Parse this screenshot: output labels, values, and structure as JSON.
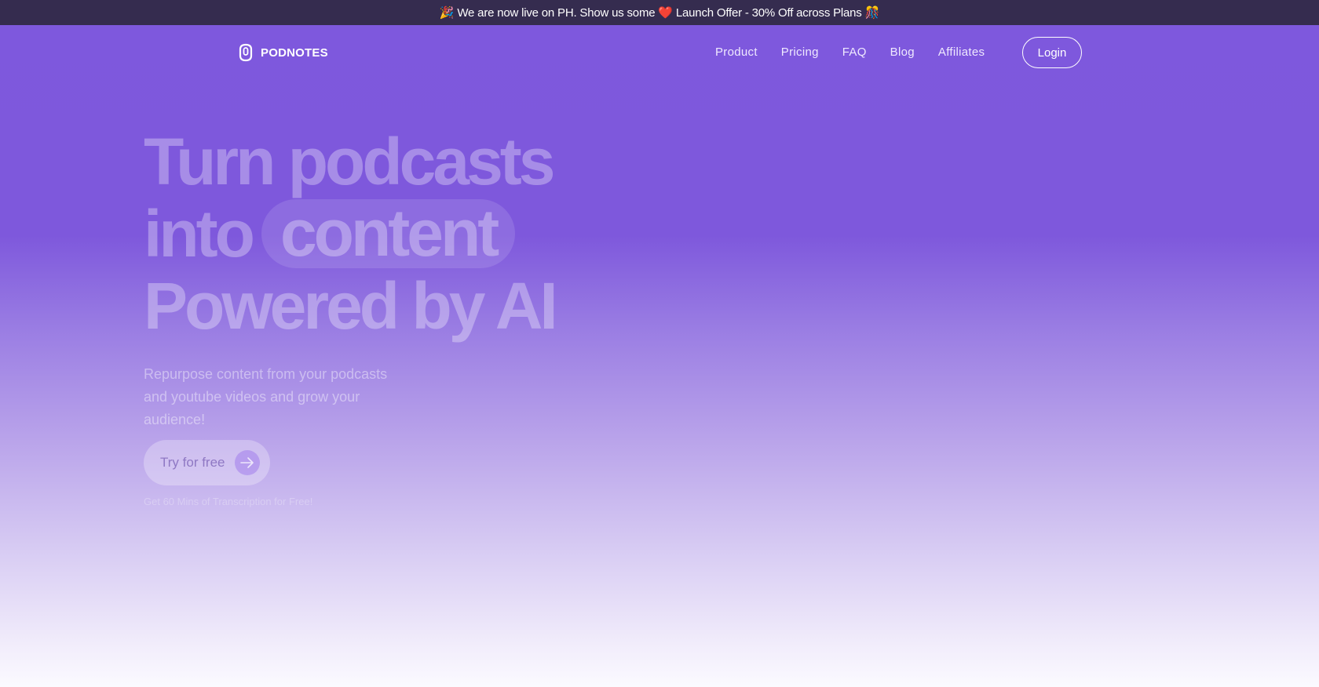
{
  "banner": {
    "emoji_left": "🎉",
    "text_before": "We are now live on PH. Show us some",
    "heart": "❤️",
    "text_after": "Launch Offer - 30% Off across Plans",
    "emoji_right": "🎊"
  },
  "nav": {
    "brand": "PODNOTES",
    "links": [
      "Product",
      "Pricing",
      "FAQ",
      "Blog",
      "Affiliates"
    ],
    "login": "Login"
  },
  "hero": {
    "line1": "Turn podcasts",
    "line2_prefix": "into",
    "line2_pill": "content",
    "line3": "Powered by AI",
    "subtitle": "Repurpose content from your podcasts and youtube videos and grow your audience!",
    "cta": "Try for free",
    "note": "Get 60 Mins of Transcription for Free!"
  },
  "colors": {
    "banner_bg": "#352c4f",
    "brand_purple": "#7e58dd"
  }
}
